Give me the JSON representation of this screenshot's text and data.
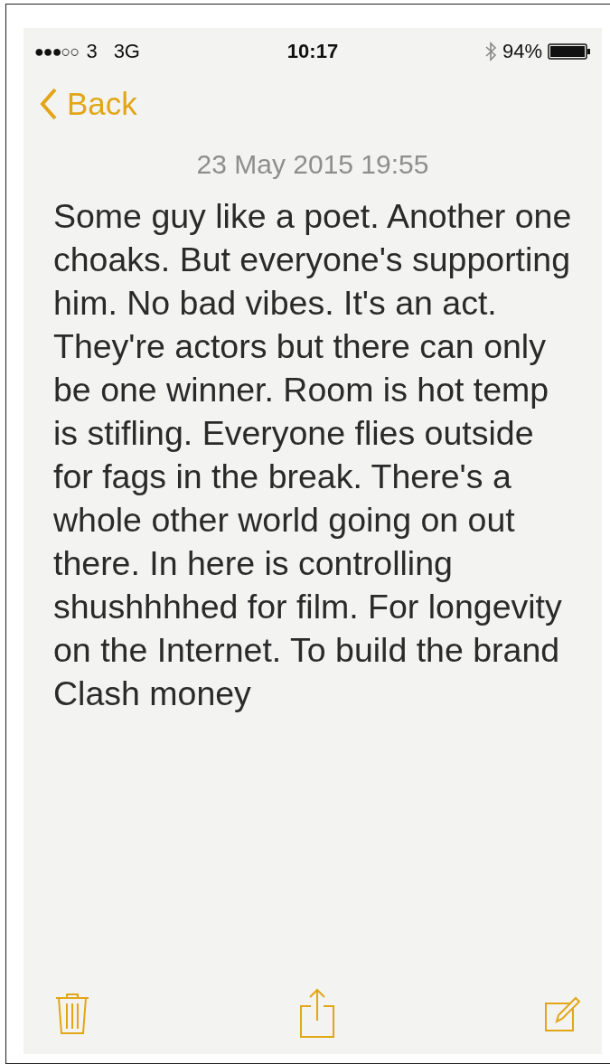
{
  "status_bar": {
    "signal": "●●●○○",
    "carrier": "3",
    "network": "3G",
    "time": "10:17",
    "battery_percent": "94%"
  },
  "nav_bar": {
    "back_label": "Back"
  },
  "note": {
    "date": "23 May 2015 19:55",
    "body": "Some guy like a poet. Another one choaks. But everyone's supporting him. No bad vibes. It's an act. They're actors but there can only be one winner. Room is hot temp is stifling. Everyone flies outside for fags in the break. There's a whole other world going on out there. In here is controlling shushhhhed for film. For longevity on the Internet. To build the brand Clash money"
  }
}
